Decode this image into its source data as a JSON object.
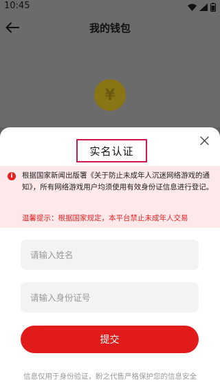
{
  "status_bar": {
    "time": "10:45"
  },
  "header": {
    "title": "我的钱包"
  },
  "wallet": {
    "coin_symbol": "¥"
  },
  "dialog": {
    "title": "实名认证",
    "notice_text": "根据国家新闻出版署《关于防止未成年人沉迷网络游戏的通知》，所有网络游戏用户均须使用有效身份证信息进行登记。",
    "warning_text": "温馨提示：根据国家规定，本平台禁止未成年人交易",
    "name_placeholder": "请输入姓名",
    "id_placeholder": "请输入身份证号",
    "submit_label": "提交",
    "footer_note": "信息仅用于身份验证，盼之代售严格保护您的信息安全"
  },
  "colors": {
    "accent": "#e11a1a",
    "title_highlight": "#d0164a",
    "notice_bg": "#fde8ea"
  }
}
